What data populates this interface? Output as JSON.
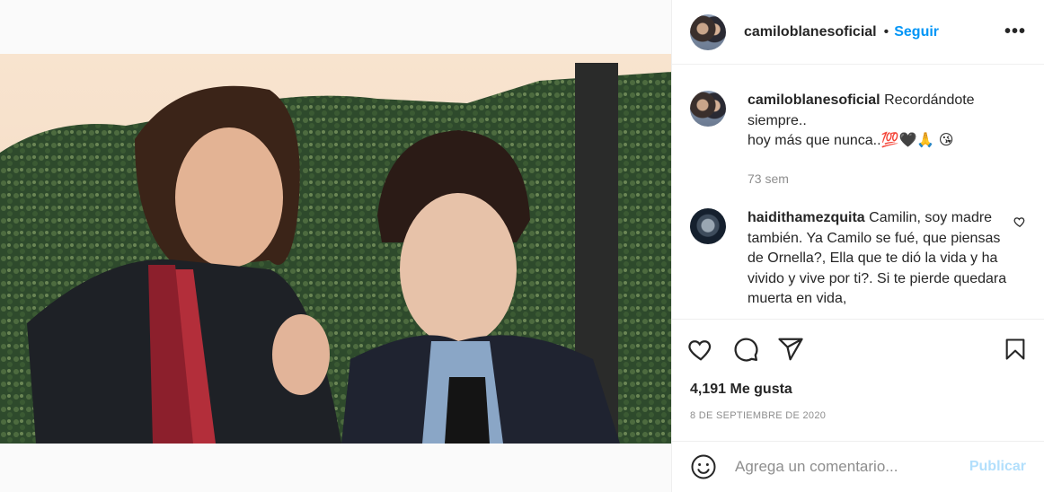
{
  "post": {
    "username": "camiloblanesoficial",
    "follow_label": "Seguir",
    "dot": "•",
    "more_label": "•••"
  },
  "caption": {
    "username": "camiloblanesoficial",
    "line1": "Recordándote siempre..",
    "line2": "hoy más que nunca..",
    "emojis": "💯🖤🙏 😘",
    "time": "73 sem"
  },
  "comment": {
    "username": "haidithamezquita",
    "text": "Camilin, soy madre también. Ya Camilo se fué, que piensas de Ornella?, Ella que te dió la vida y ha vivido y vive por ti?. Si te pierde quedara muerta en vida,"
  },
  "likes": "4,191 Me gusta",
  "date": "8 DE SEPTIEMBRE DE 2020",
  "add_comment": {
    "placeholder": "Agrega un comentario...",
    "publish_label": "Publicar"
  },
  "colors": {
    "accent": "#0095f6",
    "publish_disabled": "#b2dffc",
    "muted": "#8e8e8e"
  },
  "icons": [
    "heart-icon",
    "comment-icon",
    "share-icon",
    "bookmark-icon",
    "emoji-icon",
    "more-icon"
  ]
}
